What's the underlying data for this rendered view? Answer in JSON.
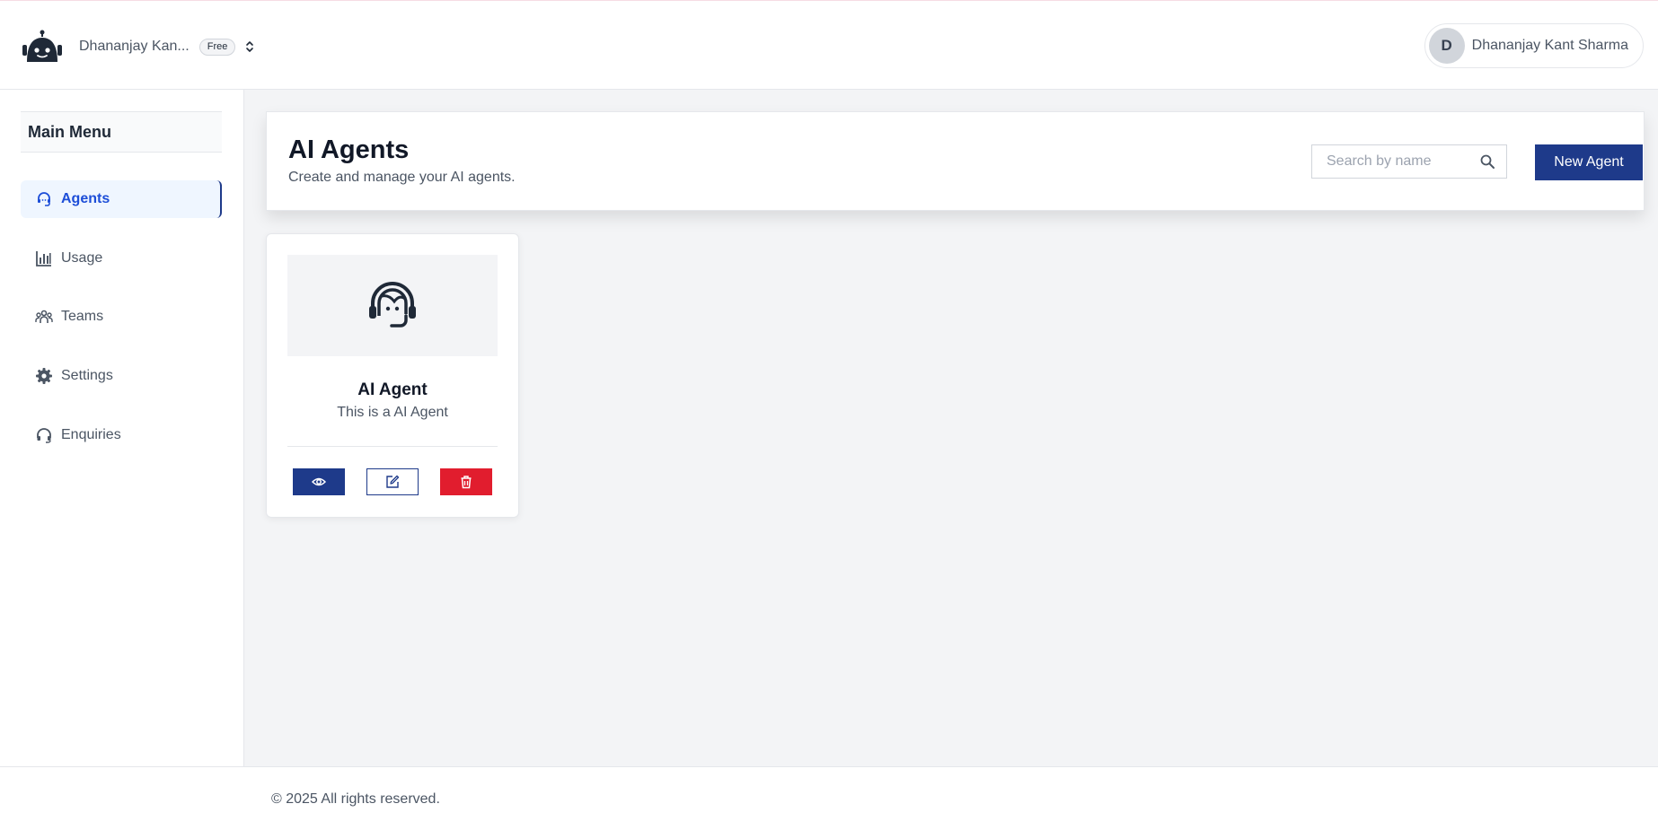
{
  "header": {
    "workspace_name": "Dhananjay Kan...",
    "plan_badge": "Free",
    "user": {
      "avatar_initial": "D",
      "name": "Dhananjay Kant Sharma"
    },
    "icons": [
      "robot-logo-icon",
      "chevrons-up-down-icon"
    ]
  },
  "sidebar": {
    "title": "Main Menu",
    "items": [
      {
        "label": "Agents",
        "icon": "headset-icon",
        "active": true
      },
      {
        "label": "Usage",
        "icon": "bar-chart-icon",
        "active": false
      },
      {
        "label": "Teams",
        "icon": "users-icon",
        "active": false
      },
      {
        "label": "Settings",
        "icon": "gear-icon",
        "active": false
      },
      {
        "label": "Enquiries",
        "icon": "headphones-icon",
        "active": false
      }
    ]
  },
  "main": {
    "title": "AI Agents",
    "subtitle": "Create and manage your AI agents.",
    "search": {
      "placeholder": "Search by name",
      "value": ""
    },
    "new_agent_label": "New Agent",
    "agents": [
      {
        "name": "AI Agent",
        "description": "This is a AI Agent",
        "icon": "support-agent-icon",
        "actions": [
          "eye-icon",
          "edit-icon",
          "trash-icon"
        ]
      }
    ]
  },
  "footer": {
    "text": "© 2025 All rights reserved."
  },
  "colors": {
    "primary": "#1e3a8a",
    "active_text": "#1d4ed8",
    "active_bg": "#eff6ff",
    "danger": "#e11d2e",
    "page_bg": "#f3f4f6"
  }
}
